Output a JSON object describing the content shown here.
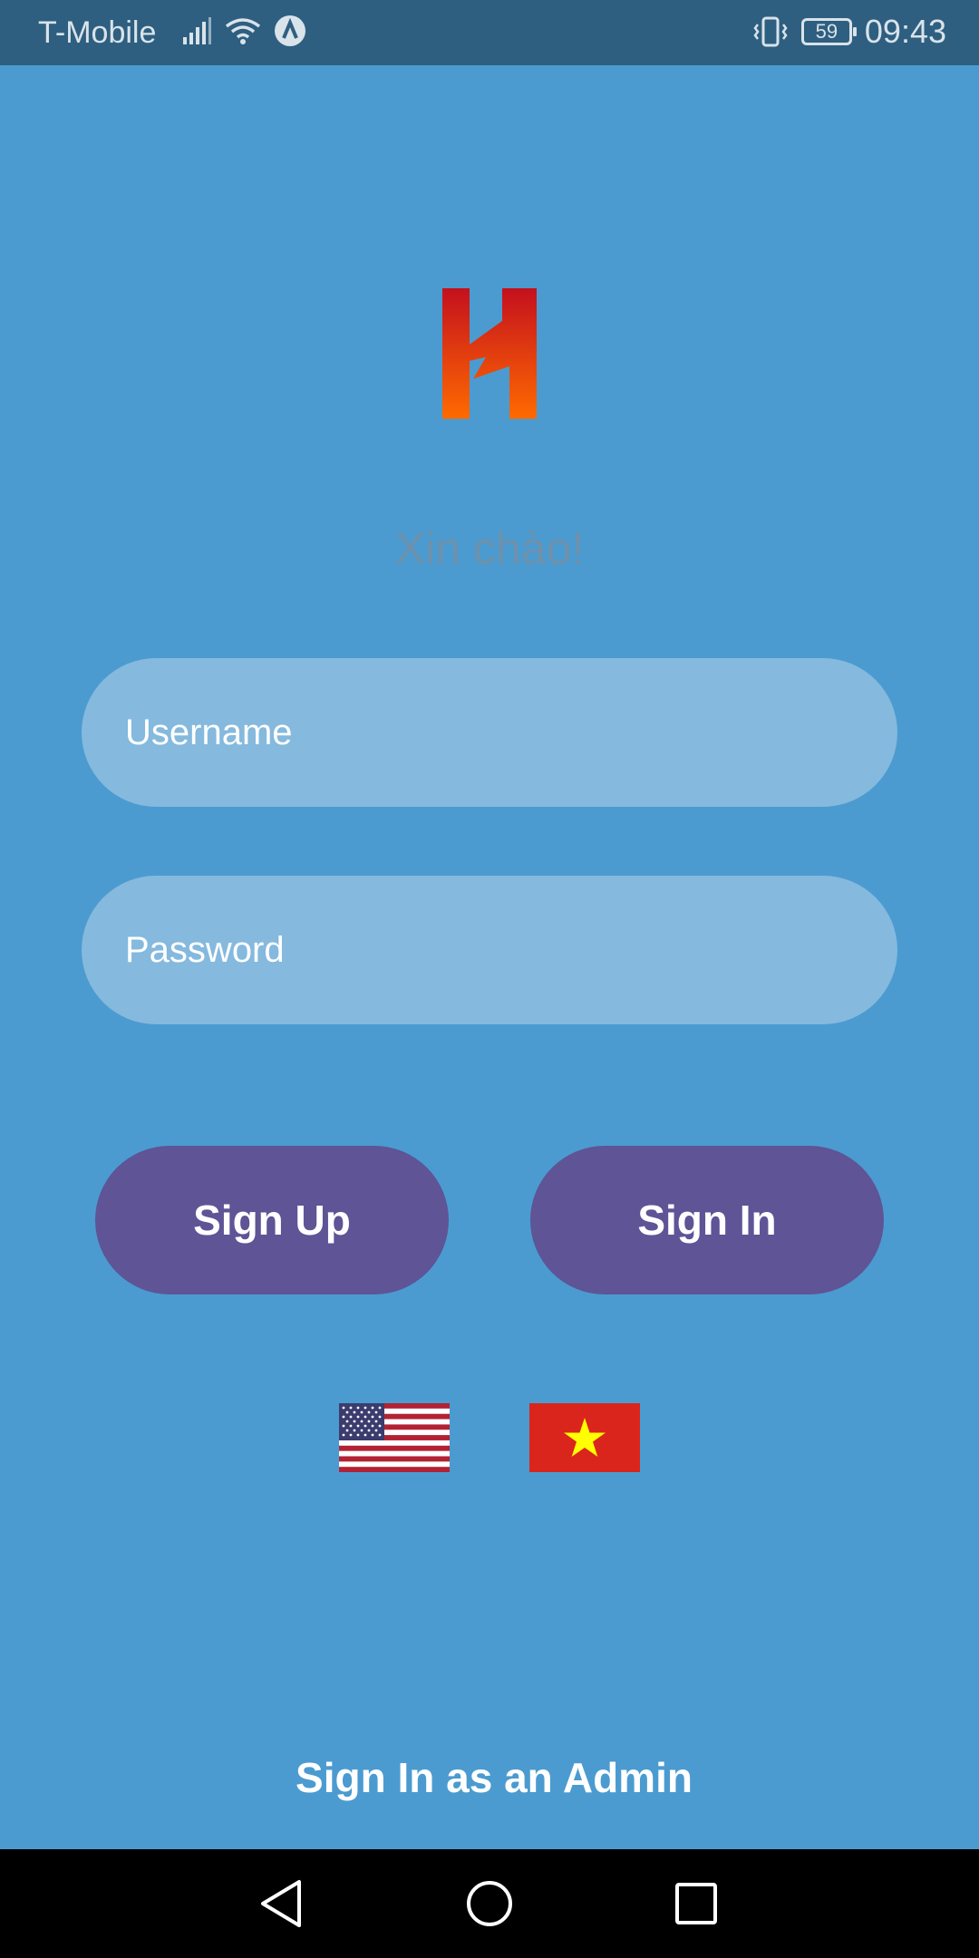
{
  "status_bar": {
    "carrier": "T-Mobile",
    "battery": "59",
    "time": "09:43"
  },
  "login": {
    "greeting": "Xin chào!",
    "username_placeholder": "Username",
    "password_placeholder": "Password",
    "sign_up_label": "Sign Up",
    "sign_in_label": "Sign In",
    "admin_link": "Sign In as an Admin"
  },
  "colors": {
    "background": "#4b9bd0",
    "status_bar": "#2e5f80",
    "input_fill": "#85b9de",
    "button": "#5e5496",
    "logo_top": "#c4101e",
    "logo_bottom": "#ff6a00"
  },
  "languages": [
    {
      "icon": "us-flag-icon"
    },
    {
      "icon": "vietnam-flag-icon"
    }
  ],
  "nav": {
    "icons": [
      "back-icon",
      "home-icon",
      "recent-apps-icon"
    ]
  }
}
